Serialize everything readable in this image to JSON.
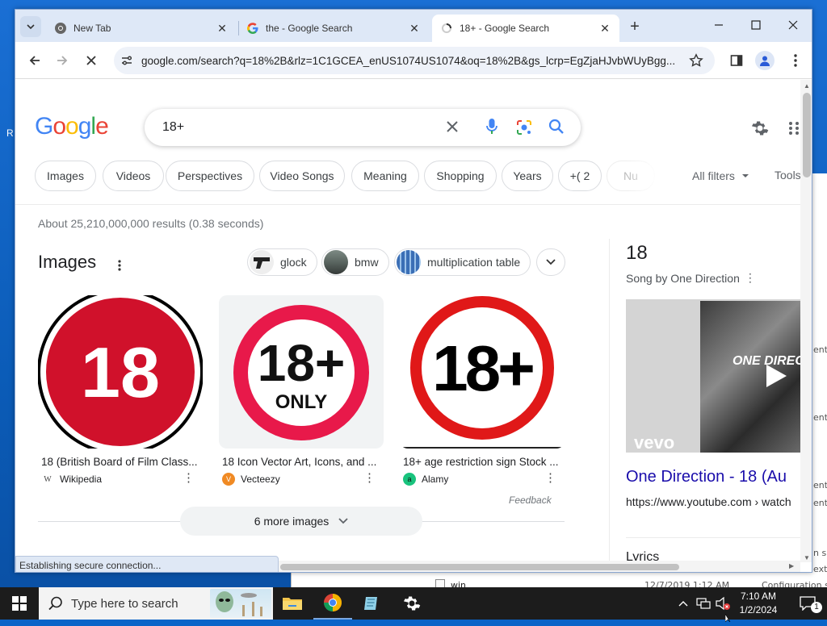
{
  "browser": {
    "tabs": [
      {
        "label": "New Tab"
      },
      {
        "label": "the - Google Search"
      },
      {
        "label": "18+ - Google Search"
      }
    ],
    "new_tab_symbol": "+",
    "url": "google.com/search?q=18%2B&rlz=1C1GCEA_enUS1074US1074&oq=18%2B&gs_lcrp=EgZjaHJvbWUyBgg...",
    "status_text": "Establishing secure connection..."
  },
  "google": {
    "logo": "Google",
    "query": "18+",
    "chips": [
      "Images",
      "Videos",
      "Perspectives",
      "Video Songs",
      "Meaning",
      "Shopping",
      "Years",
      "+( 2",
      "Nu"
    ],
    "all_filters": "All filters",
    "tools": "Tools",
    "results_count": "About 25,210,000,000 results (0.38 seconds)"
  },
  "images_section": {
    "title": "Images",
    "related": [
      {
        "label": "glock"
      },
      {
        "label": "bmw"
      },
      {
        "label": "multiplication table"
      }
    ],
    "cards": [
      {
        "caption": "18 (British Board of Film Class...",
        "source": "Wikipedia",
        "source_icon": "W",
        "badge": "18"
      },
      {
        "caption": "18 Icon Vector Art, Icons, and ...",
        "source": "Vecteezy",
        "source_icon": "V",
        "badge": "18+",
        "sub": "ONLY"
      },
      {
        "caption": "18+ age restriction sign Stock ...",
        "source": "Alamy",
        "source_icon": "a",
        "badge": "18+"
      }
    ],
    "feedback": "Feedback",
    "more_images": "6 more images"
  },
  "knowledge_panel": {
    "title": "18",
    "subtitle": "Song by One Direction",
    "video_overlay": "ONE DIRECT",
    "vevo": "vevo",
    "link_title": "One Direction - 18 (Au",
    "link_url": "https://www.youtube.com › watch",
    "cutoff": "Lyrics"
  },
  "taskbar": {
    "search_placeholder": "Type here to search",
    "time": "7:10 AM",
    "date": "1/2/2024",
    "notif_count": "1"
  },
  "background_window": {
    "file_name": "win",
    "file_date": "12/7/2019 1:12 AM",
    "file_type": "Configuration s",
    "side_fragments": [
      "ent",
      "ent",
      "ent",
      "ent",
      "n s",
      "exte"
    ]
  },
  "desktop": {
    "edge_letter": "R"
  },
  "colors": {
    "google_blue": "#4285F4",
    "google_red": "#EA4335",
    "google_yellow": "#FBBC05",
    "google_green": "#34A853",
    "link_blue": "#1a0dab",
    "sign_red": "#d0112b"
  }
}
